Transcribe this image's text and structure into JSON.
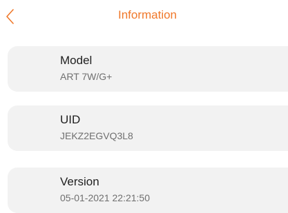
{
  "header": {
    "title": "Information",
    "back_icon": "chevron-left-icon",
    "accent_color": "#f0782a"
  },
  "info": [
    {
      "label": "Model",
      "value": "ART 7W/G+"
    },
    {
      "label": "UID",
      "value": "JEKZ2EGVQ3L8"
    },
    {
      "label": "Version",
      "value": "05-01-2021 22:21:50"
    }
  ]
}
